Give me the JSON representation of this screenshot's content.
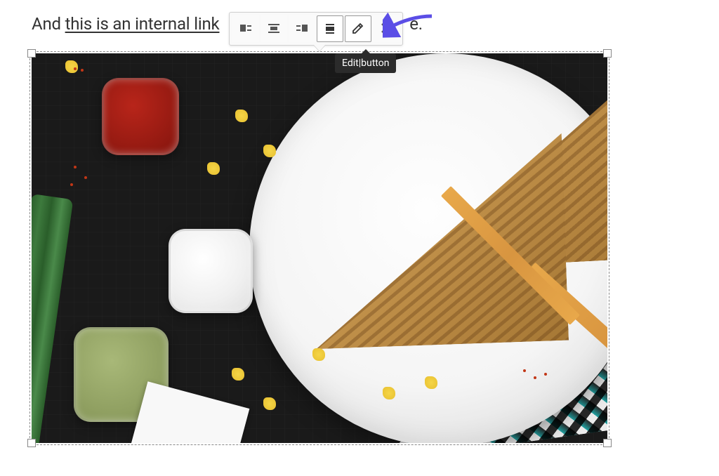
{
  "content": {
    "text_before": "And ",
    "link_text": "this is an internal link",
    "text_after_visible": "e."
  },
  "toolbar": {
    "align_left_label": "Align left",
    "align_center_label": "Align center",
    "align_right_label": "Align right",
    "align_none_label": "No alignment",
    "edit_label": "Edit",
    "remove_label": "Remove"
  },
  "tooltip": {
    "text": "Edit|button"
  },
  "annotation": {
    "arrow_color": "#5b4ee6"
  }
}
